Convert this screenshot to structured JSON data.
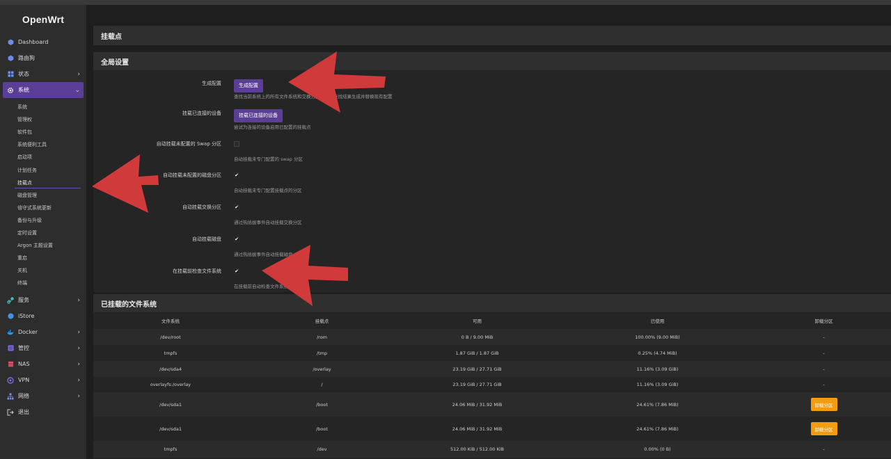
{
  "brand": "OpenWrt",
  "nav": {
    "dashboard": "Dashboard",
    "router_dog": "路由狗",
    "status": "状态",
    "system": "系统",
    "services": "服务",
    "istore": "iStore",
    "docker": "Docker",
    "control": "管控",
    "nas": "NAS",
    "vpn": "VPN",
    "network": "网络",
    "logout": "退出",
    "system_sub": [
      "系统",
      "管理权",
      "软件包",
      "系统便利工具",
      "启动项",
      "计划任务",
      "挂载点",
      "磁盘管理",
      "倍守式系统更新",
      "备份与升级",
      "定时设置",
      "Argon 主题设置",
      "重启",
      "关机",
      "终端"
    ]
  },
  "page_title": "挂载点",
  "global": {
    "title": "全局设置",
    "generate_label": "生成配置",
    "generate_btn": "生成配置",
    "generate_desc": "查找当前系统上的所有文件系统和交换分区，根据查找结果生成并替换现有配置",
    "mount_label": "挂载已连接的设备",
    "mount_btn": "挂载已连接的设备",
    "mount_desc": "尝试为连接的设备启用已配置的挂载点",
    "swap_label": "自动挂载未配置的 Swap 分区",
    "swap_desc": "自动挂载未专门配置的 swap 分区",
    "disk_label": "自动挂载未配置的磁盘分区",
    "disk_desc": "自动挂载未专门配置挂载点的分区",
    "hotswap_label": "自动挂载交换分区",
    "hotswap_desc": "通过热插拔事件自动挂载交换分区",
    "hotdisk_label": "自动挂载磁盘",
    "hotdisk_desc": "通过热插拔事件自动挂载磁盘",
    "check_label": "在挂载前检查文件系统",
    "check_desc": "在挂载前自动检查文件系统错误"
  },
  "checks": {
    "swap": false,
    "disk": true,
    "hotswap": true,
    "hotdisk": true,
    "check": true
  },
  "mounted": {
    "title": "已挂载的文件系统",
    "headers": [
      "文件系统",
      "挂载点",
      "可用",
      "已使用",
      "卸载分区"
    ],
    "rows": [
      {
        "fs": "/dev/root",
        "mp": "/rom",
        "avail": "0 B / 9.00 MiB",
        "used": "100.00% (9.00 MiB)",
        "action": "-"
      },
      {
        "fs": "tmpfs",
        "mp": "/tmp",
        "avail": "1.87 GiB / 1.87 GiB",
        "used": "0.25% (4.74 MiB)",
        "action": "-"
      },
      {
        "fs": "/dev/sda4",
        "mp": "/overlay",
        "avail": "23.19 GiB / 27.71 GiB",
        "used": "11.16% (3.09 GiB)",
        "action": "-"
      },
      {
        "fs": "overlayfs:/overlay",
        "mp": "/",
        "avail": "23.19 GiB / 27.71 GiB",
        "used": "11.16% (3.09 GiB)",
        "action": "-"
      },
      {
        "fs": "/dev/sda1",
        "mp": "/boot",
        "avail": "24.06 MiB / 31.92 MiB",
        "used": "24.61% (7.86 MiB)",
        "action": "卸载分区"
      },
      {
        "fs": "/dev/sda1",
        "mp": "/boot",
        "avail": "24.06 MiB / 31.92 MiB",
        "used": "24.61% (7.86 MiB)",
        "action": "卸载分区"
      },
      {
        "fs": "tmpfs",
        "mp": "/dev",
        "avail": "512.00 KiB / 512.00 KiB",
        "used": "0.00% (0 B)",
        "action": "-"
      }
    ]
  },
  "colors": {
    "accent": "#5b3f96",
    "unmount": "#f39c12",
    "arrow": "#d64541"
  }
}
